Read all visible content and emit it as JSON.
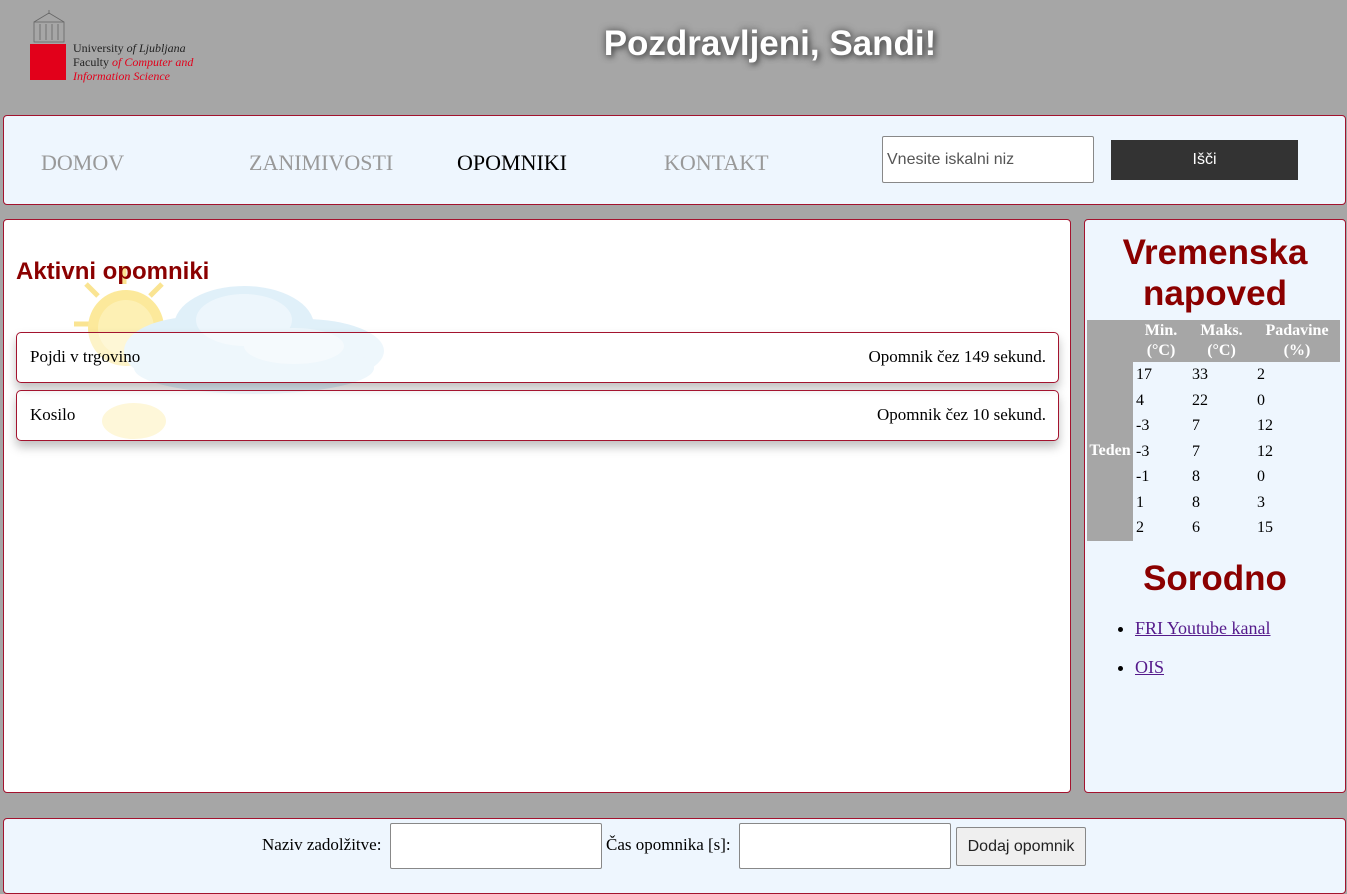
{
  "header": {
    "logo": {
      "line1_a": "University",
      "line1_b": "of Ljubljana",
      "line2_a": "Faculty",
      "line2_b": "of Computer and",
      "line3": "Information Science"
    },
    "greeting": "Pozdravljeni, Sandi!"
  },
  "nav": {
    "items": [
      {
        "label": "DOMOV",
        "active": false
      },
      {
        "label": "ZANIMIVOSTI",
        "active": false
      },
      {
        "label": "OPOMNIKI",
        "active": true
      },
      {
        "label": "KONTAKT",
        "active": false
      }
    ],
    "search": {
      "placeholder": "Vnesite iskalni niz",
      "button_label": "Išči"
    }
  },
  "main": {
    "title": "Aktivni opomniki",
    "reminders": [
      {
        "name": "Pojdi v trgovino",
        "time": "Opomnik čez 149 sekund."
      },
      {
        "name": "Kosilo",
        "time": "Opomnik čez 10 sekund."
      }
    ]
  },
  "sidebar": {
    "weather_title": "Vremenska napoved",
    "table": {
      "row_header": "Teden",
      "headers": [
        "Min. (°C)",
        "Maks. (°C)",
        "Padavine (%)"
      ],
      "rows": [
        [
          "17",
          "33",
          "2"
        ],
        [
          "4",
          "22",
          "0"
        ],
        [
          "-3",
          "7",
          "12"
        ],
        [
          "-3",
          "7",
          "12"
        ],
        [
          "-1",
          "8",
          "0"
        ],
        [
          "1",
          "8",
          "3"
        ],
        [
          "2",
          "6",
          "15"
        ]
      ]
    },
    "related_title": "Sorodno",
    "links": [
      "FRI Youtube kanal",
      "OIS"
    ]
  },
  "footer": {
    "task_label": "Naziv zadolžitve:",
    "time_label": "Čas opomnika [s]:",
    "add_button": "Dodaj opomnik"
  },
  "colors": {
    "page_bg": "#a6a6a6",
    "panel_bg": "#eef6fe",
    "accent": "#8b0000",
    "border": "#a3132e",
    "search_button": "#333333"
  }
}
